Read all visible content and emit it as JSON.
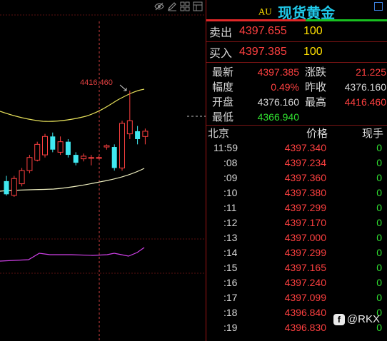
{
  "chart": {
    "high_annotation": "4416.460",
    "candles": [
      {
        "o": 4382.0,
        "c": 4377.0,
        "h": 4384.0,
        "l": 4376.5
      },
      {
        "o": 4376.6,
        "c": 4383.0,
        "h": 4384.0,
        "l": 4376.0
      },
      {
        "o": 4381.0,
        "c": 4386.0,
        "h": 4387.0,
        "l": 4380.0
      },
      {
        "o": 4386.0,
        "c": 4391.0,
        "h": 4392.0,
        "l": 4385.0
      },
      {
        "o": 4390.0,
        "c": 4396.0,
        "h": 4397.0,
        "l": 4389.5
      },
      {
        "o": 4392.0,
        "c": 4399.0,
        "h": 4400.0,
        "l": 4391.0
      },
      {
        "o": 4399.0,
        "c": 4394.0,
        "h": 4400.5,
        "l": 4393.0
      },
      {
        "o": 4393.0,
        "c": 4397.0,
        "h": 4399.0,
        "l": 4392.0
      },
      {
        "o": 4397.0,
        "c": 4392.0,
        "h": 4398.0,
        "l": 4391.0
      },
      {
        "o": 4392.0,
        "c": 4389.0,
        "h": 4393.0,
        "l": 4388.0
      },
      {
        "o": 4390.5,
        "c": 4391.5,
        "h": 4392.5,
        "l": 4389.5
      },
      {
        "o": 4391.0,
        "c": 4391.0,
        "h": 4392.0,
        "l": 4388.0
      },
      {
        "o": 4391.0,
        "c": 4391.0,
        "h": 4391.5,
        "l": 4390.5
      },
      {
        "o": 4395.0,
        "c": 4395.5,
        "h": 4396.0,
        "l": 4394.0
      },
      {
        "o": 4395.0,
        "c": 4387.0,
        "h": 4396.0,
        "l": 4386.0
      },
      {
        "o": 4387.0,
        "c": 4404.0,
        "h": 4405.0,
        "l": 4386.0
      },
      {
        "o": 4400.0,
        "c": 4405.0,
        "h": 4416.46,
        "l": 4398.0
      },
      {
        "o": 4401.0,
        "c": 4398.0,
        "h": 4403.0,
        "l": 4396.0
      },
      {
        "o": 4399.0,
        "c": 4401.0,
        "h": 4402.0,
        "l": 4396.0
      }
    ]
  },
  "quote": {
    "code": "AU",
    "name": "现货黄金",
    "buy_ratio": 0.55,
    "sell": {
      "label": "卖出",
      "price": "4397.655",
      "volume": "100"
    },
    "buy": {
      "label": "买入",
      "price": "4397.385",
      "volume": "100"
    },
    "stats": {
      "latest_label": "最新",
      "latest": "4397.385",
      "change_label": "涨跌",
      "change": "21.225",
      "amplitude_label": "幅度",
      "amplitude": "0.49%",
      "prev_close_label": "昨收",
      "prev_close": "4376.160",
      "open_label": "开盘",
      "open": "4376.160",
      "high_label": "最高",
      "high": "4416.460",
      "low_label": "最低",
      "low": "4366.940"
    },
    "ticks_header": {
      "time": "北京",
      "price": "价格",
      "volume": "现手"
    },
    "ticks": [
      {
        "time": "11:59",
        "price": "4397.340",
        "volume": "0"
      },
      {
        "time": ":08",
        "price": "4397.234",
        "volume": "0"
      },
      {
        "time": ":09",
        "price": "4397.360",
        "volume": "0"
      },
      {
        "time": ":10",
        "price": "4397.380",
        "volume": "0"
      },
      {
        "time": ":11",
        "price": "4397.299",
        "volume": "0"
      },
      {
        "time": ":12",
        "price": "4397.170",
        "volume": "0"
      },
      {
        "time": ":13",
        "price": "4397.000",
        "volume": "0"
      },
      {
        "time": ":14",
        "price": "4397.299",
        "volume": "0"
      },
      {
        "time": ":15",
        "price": "4397.165",
        "volume": "0"
      },
      {
        "time": ":16",
        "price": "4397.240",
        "volume": "0"
      },
      {
        "time": ":17",
        "price": "4397.099",
        "volume": "0"
      },
      {
        "time": ":18",
        "price": "4396.840",
        "volume": "0"
      },
      {
        "time": ":19",
        "price": "4396.830",
        "volume": "0"
      }
    ]
  },
  "watermark": {
    "text": "@RKX",
    "icon": "f"
  },
  "colors": {
    "up": "#ff4040",
    "down_candle": "#40e8f0",
    "down": "#30e030",
    "title": "#20c8e8",
    "volume_yellow": "#ffe000",
    "band_upper": "#e6e05a",
    "band_lower": "#f0f0c0",
    "indicator": "#d040e8",
    "crosshair": "#d04040"
  },
  "icons": [
    "eye-icon",
    "pencil-icon",
    "grid-icon",
    "layout-icon",
    "window-icon"
  ]
}
